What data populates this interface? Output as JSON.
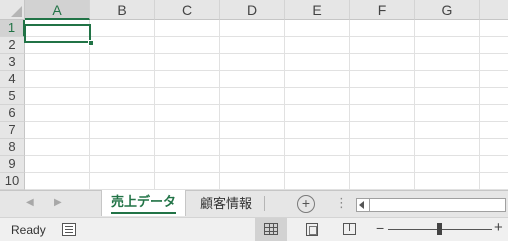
{
  "grid": {
    "columns": [
      "A",
      "B",
      "C",
      "D",
      "E",
      "F",
      "G"
    ],
    "rows": [
      "1",
      "2",
      "3",
      "4",
      "5",
      "6",
      "7",
      "8",
      "9",
      "10"
    ],
    "active_cell": "A1"
  },
  "sheet_tabs": {
    "active": "売上データ",
    "others": [
      "顧客情報"
    ],
    "add_symbol": "+",
    "more_symbol": "⋮",
    "prev_symbol": "◀",
    "next_symbol": "▶"
  },
  "status_bar": {
    "status": "Ready",
    "zoom_minus": "−",
    "zoom_plus": "+",
    "zoom_level_fraction": 0.5
  },
  "colors": {
    "accent": "#217346",
    "header_bg": "#e6e6e6",
    "gridline": "#e1e1e1"
  },
  "icons": [
    "macro-record-icon",
    "normal-view-icon",
    "page-layout-view-icon",
    "page-break-preview-icon",
    "add-sheet-icon",
    "ellipsis-icon"
  ]
}
